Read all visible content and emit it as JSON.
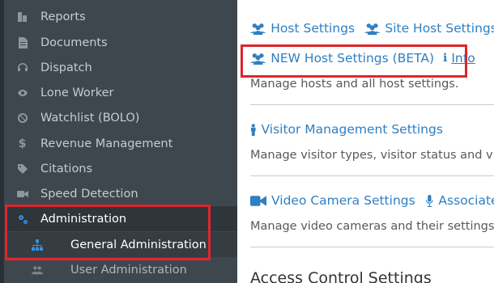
{
  "sidebar": {
    "items": [
      {
        "label": "Reports",
        "icon": "reports-icon"
      },
      {
        "label": "Documents",
        "icon": "document-icon"
      },
      {
        "label": "Dispatch",
        "icon": "headset-icon"
      },
      {
        "label": "Lone Worker",
        "icon": "eye-icon"
      },
      {
        "label": "Watchlist (BOLO)",
        "icon": "ban-icon"
      },
      {
        "label": "Revenue Management",
        "icon": "dollar-icon"
      },
      {
        "label": "Citations",
        "icon": "tag-icon"
      },
      {
        "label": "Speed Detection",
        "icon": "video-icon"
      },
      {
        "label": "Administration",
        "icon": "cogs-icon"
      }
    ],
    "sub_items": [
      {
        "label": "General Administration",
        "icon": "sitemap-icon"
      },
      {
        "label": "User Administration",
        "icon": "users-icon"
      }
    ]
  },
  "content": {
    "host_links": [
      "Host Settings",
      "Site Host Settings"
    ],
    "new_host_settings": "NEW Host Settings (BETA)",
    "info_label": "Info",
    "host_desc": "Manage hosts and all host settings.",
    "visitor_link": "Visitor Management Settings",
    "visitor_desc": "Manage visitor types, visitor status and vis",
    "video_link": "Video Camera Settings",
    "associated_link": "Associated S",
    "video_desc": "Manage video cameras and their settings,",
    "access_title": "Access Control Settings"
  },
  "colors": {
    "sidebar_bg": "#3f474e",
    "link": "#2f7fc1",
    "highlight": "#e0252b",
    "accent_icon": "#3a8fdd"
  }
}
